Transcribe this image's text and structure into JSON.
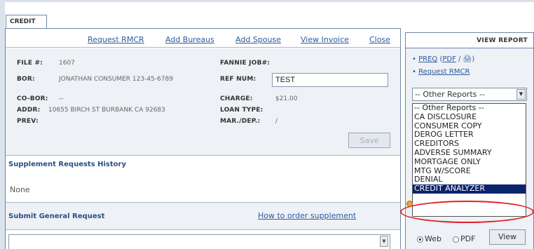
{
  "tab": {
    "label": "CREDIT"
  },
  "links": {
    "request_rmcr": "Request RMCR",
    "add_bureaus": "Add Bureaus",
    "add_spouse": "Add Spouse",
    "view_invoice": "View Invoice",
    "close": "Close"
  },
  "info": {
    "file_label": "FILE #:",
    "file_value": "1607",
    "bor_label": "BOR:",
    "bor_value": "JONATHAN CONSUMER 123-45-6789",
    "coborr_label": "CO-BOR:",
    "coborr_value": "--",
    "addr_label": "ADDR:",
    "addr_value": "10655 BIRCH ST BURBANK CA 92683",
    "prev_label": "PREV:",
    "fannie_label": "FANNIE JOB#:",
    "ref_label": "REF NUM:",
    "ref_value": "TEST",
    "charge_label": "CHARGE:",
    "charge_value": "$21.00",
    "loan_label": "LOAN TYPE:",
    "mar_label": "MAR./DEP.:",
    "mar_value": "/",
    "save_label": "Save"
  },
  "supplement": {
    "title": "Supplement Requests History",
    "value": "None"
  },
  "general": {
    "title": "Submit General Request",
    "how_to": "How to order supplement"
  },
  "side": {
    "header": "VIEW REPORT",
    "preq": "PREQ",
    "pdf_open": "(",
    "pdf": "PDF",
    "pdf_sep": " / ",
    "print_icon": "🖨",
    "pdf_close": ")",
    "request_rmcr": "Request RMCR",
    "select_value": "-- Other Reports --",
    "options": [
      "-- Other Reports --",
      "CA DISCLOSURE",
      "CONSUMER COPY",
      "DEROG LETTER",
      "CREDITORS",
      "ADVERSE SUMMARY",
      "MORTGAGE ONLY",
      "MTG W/SCORE",
      "DENIAL",
      "CREDIT ANALYZER"
    ],
    "radio_web": "Web",
    "radio_pdf": "PDF",
    "view_label": "View"
  },
  "colors": {
    "link": "#2b5aa0",
    "highlight": "#0a246a",
    "annotation": "#e21f26"
  }
}
